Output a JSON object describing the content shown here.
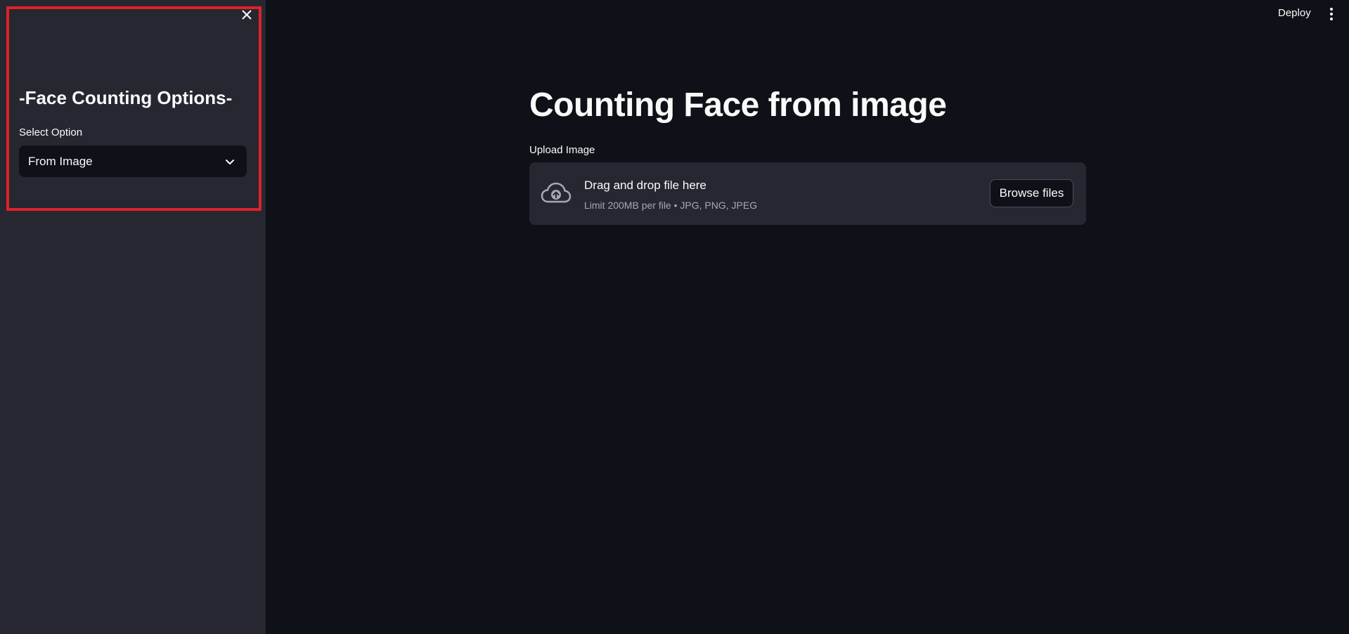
{
  "sidebar": {
    "heading": "-Face Counting Options-",
    "select_label": "Select Option",
    "select_value": "From Image",
    "close_icon": "close-icon",
    "dropdown_icon": "chevron-down-icon",
    "highlight_color": "#e0202a",
    "background": "#262730"
  },
  "toolbar": {
    "deploy_label": "Deploy",
    "menu_icon": "more-vertical-icon"
  },
  "main": {
    "title": "Counting Face from image",
    "uploader": {
      "label": "Upload Image",
      "title": "Drag and drop file here",
      "subtitle": "Limit 200MB per file • JPG, PNG, JPEG",
      "button_label": "Browse files",
      "icon": "cloud-upload-icon"
    },
    "background": "#0e1117"
  }
}
